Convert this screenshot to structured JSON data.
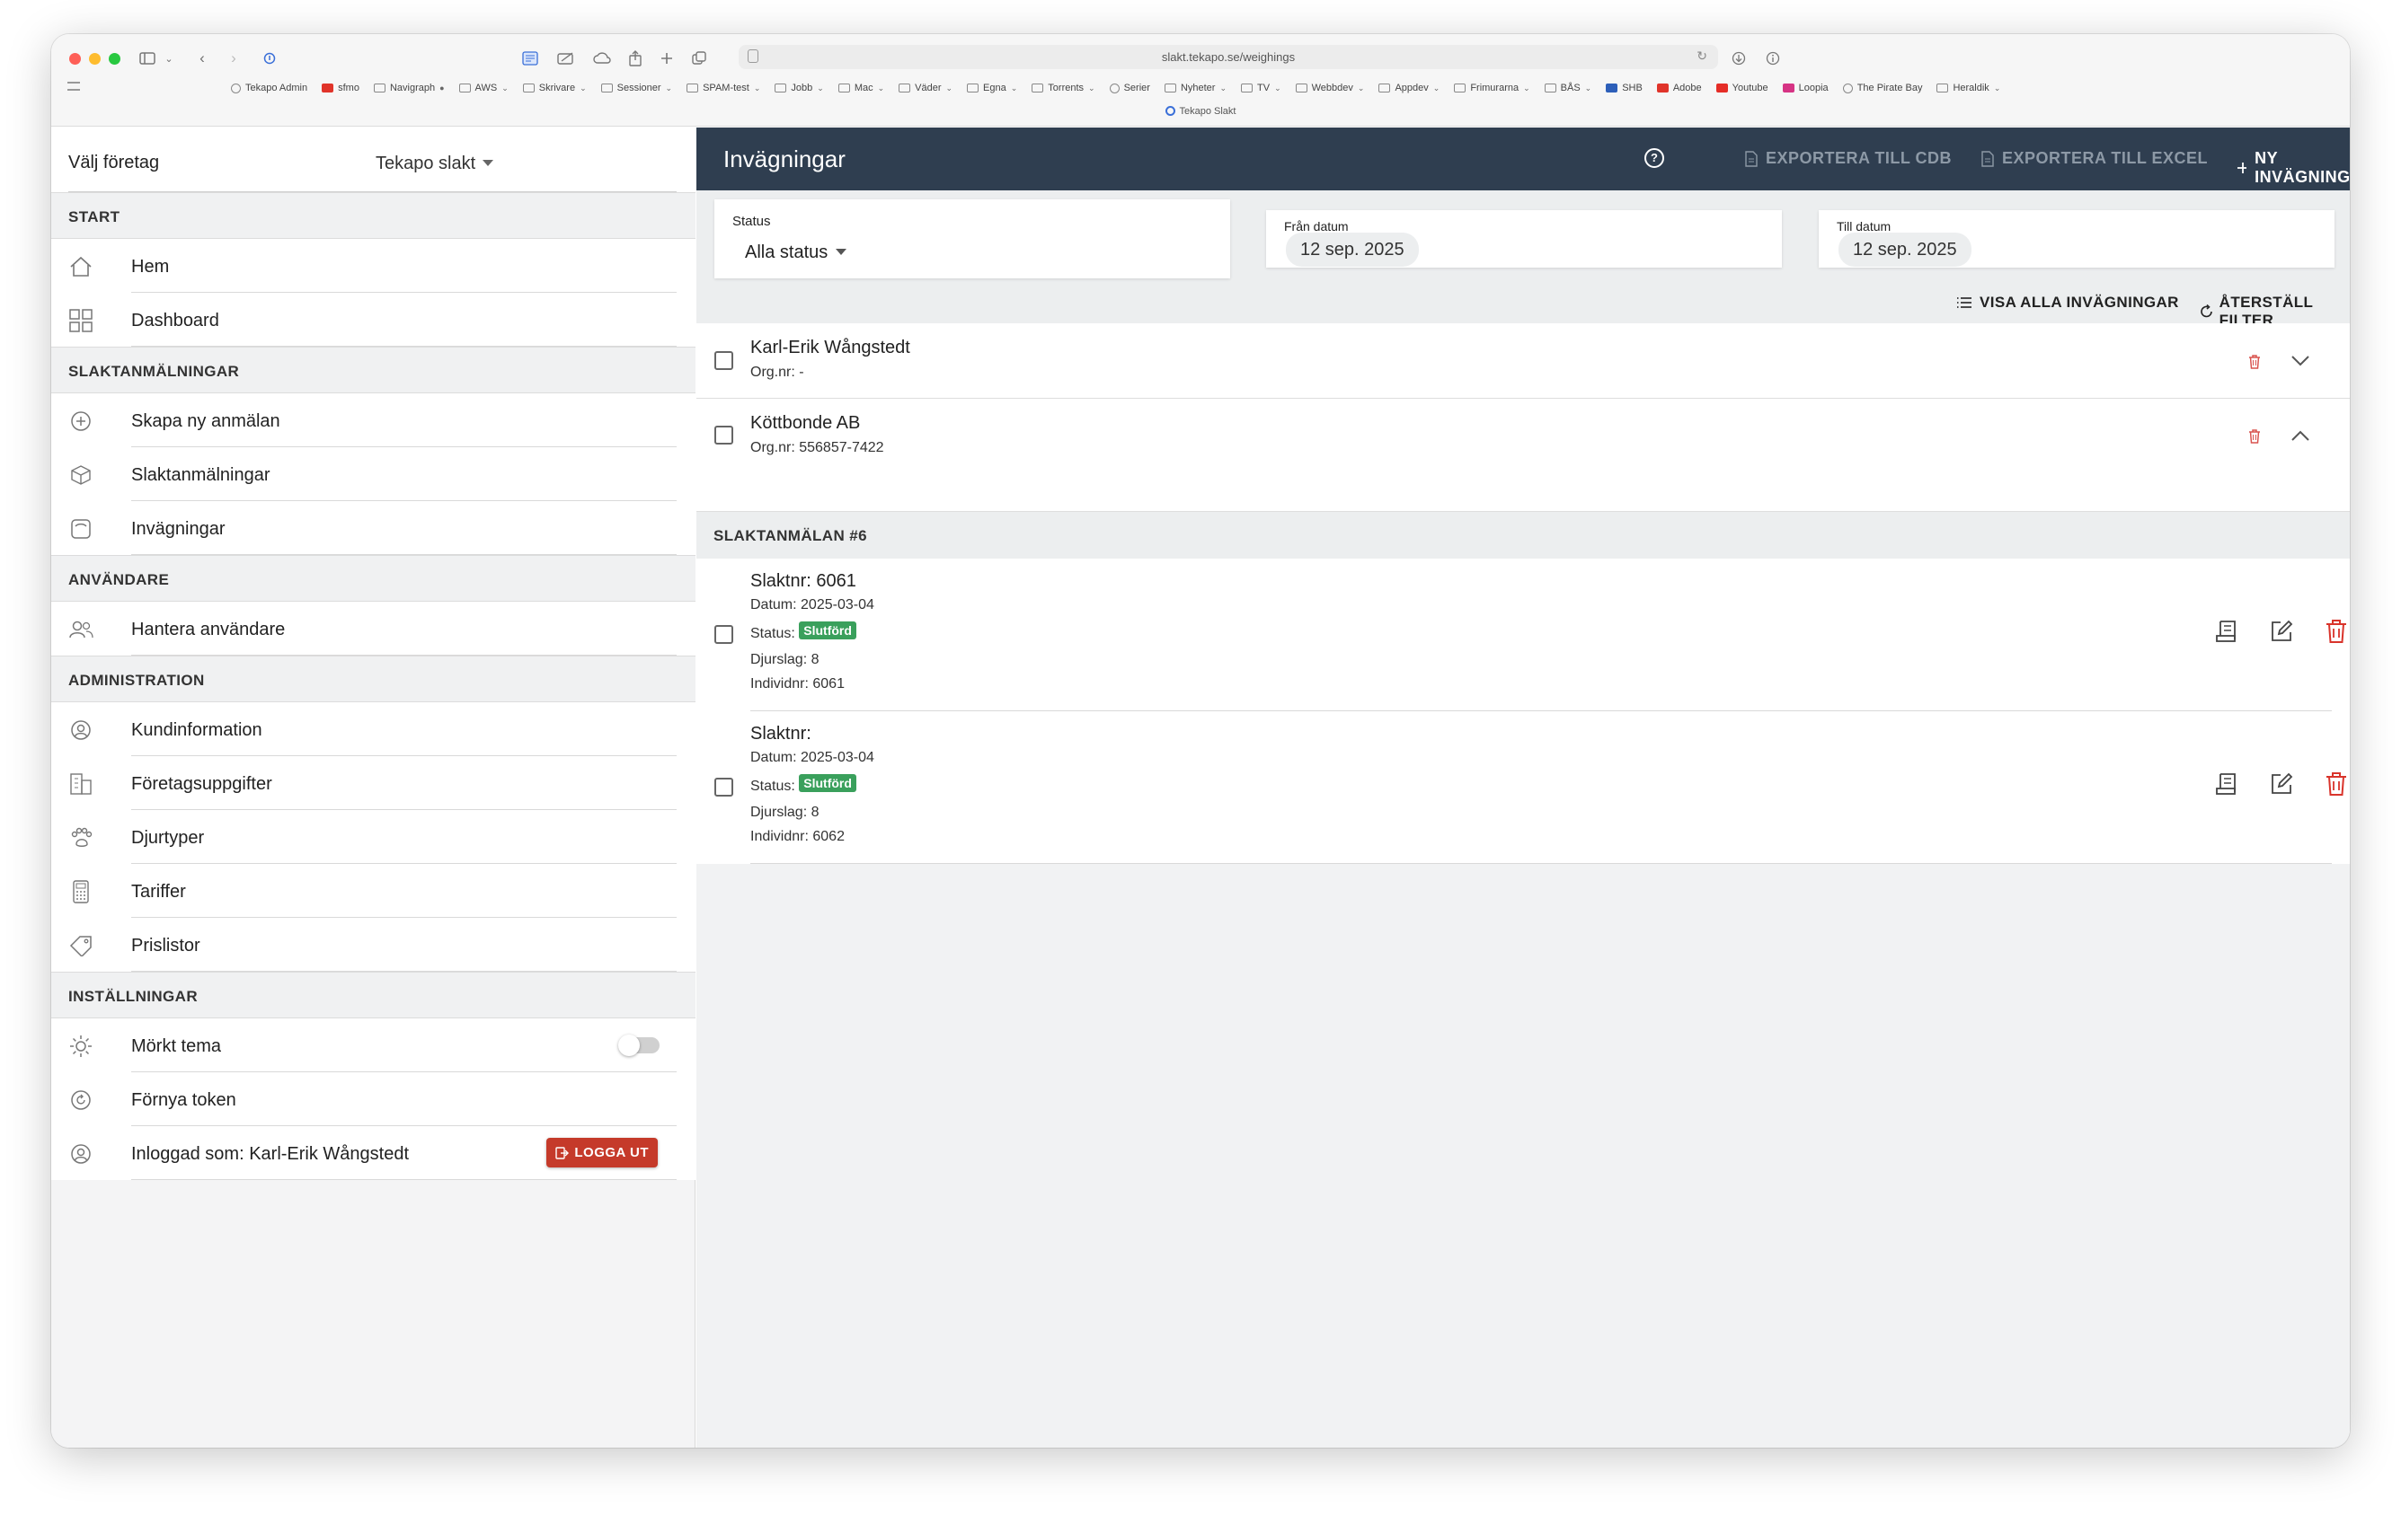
{
  "browser": {
    "url": "slakt.tekapo.se/weighings",
    "tab_title": "Tekapo Slakt",
    "bookmarks": [
      {
        "label": "Tekapo Admin",
        "icon": "globe-icon"
      },
      {
        "label": "sfmo",
        "icon": "red-cross-icon"
      },
      {
        "label": "Navigraph",
        "icon": "folder-icon",
        "chevron": "●"
      },
      {
        "label": "AWS",
        "icon": "folder-icon",
        "chevron": "⌄"
      },
      {
        "label": "Skrivare",
        "icon": "folder-icon",
        "chevron": "⌄"
      },
      {
        "label": "Sessioner",
        "icon": "folder-icon",
        "chevron": "⌄"
      },
      {
        "label": "SPAM-test",
        "icon": "folder-icon",
        "chevron": "⌄"
      },
      {
        "label": "Jobb",
        "icon": "folder-icon",
        "chevron": "⌄"
      },
      {
        "label": "Mac",
        "icon": "folder-icon",
        "chevron": "⌄"
      },
      {
        "label": "Väder",
        "icon": "folder-icon",
        "chevron": "⌄"
      },
      {
        "label": "Egna",
        "icon": "folder-icon",
        "chevron": "⌄"
      },
      {
        "label": "Torrents",
        "icon": "folder-icon",
        "chevron": "⌄"
      },
      {
        "label": "Serier",
        "icon": "globe-icon"
      },
      {
        "label": "Nyheter",
        "icon": "folder-icon",
        "chevron": "⌄"
      },
      {
        "label": "TV",
        "icon": "folder-icon",
        "chevron": "⌄"
      },
      {
        "label": "Webbdev",
        "icon": "folder-icon",
        "chevron": "⌄"
      },
      {
        "label": "Appdev",
        "icon": "folder-icon",
        "chevron": "⌄"
      },
      {
        "label": "Frimurarna",
        "icon": "folder-icon",
        "chevron": "⌄"
      },
      {
        "label": "BÅS",
        "icon": "folder-icon",
        "chevron": "⌄"
      },
      {
        "label": "SHB",
        "icon": "shb-icon"
      },
      {
        "label": "Adobe",
        "icon": "adobe-icon"
      },
      {
        "label": "Youtube",
        "icon": "youtube-icon"
      },
      {
        "label": "Loopia",
        "icon": "loopia-icon"
      },
      {
        "label": "The Pirate Bay",
        "icon": "pirate-icon"
      },
      {
        "label": "Heraldik",
        "icon": "folder-icon",
        "chevron": "⌄"
      }
    ]
  },
  "sidebar": {
    "company_label": "Välj företag",
    "company_value": "Tekapo slakt",
    "sections": {
      "start": "START",
      "slakt": "SLAKTANMÄLNINGAR",
      "users": "ANVÄNDARE",
      "admin": "ADMINISTRATION",
      "settings": "INSTÄLLNINGAR"
    },
    "items": {
      "home": "Hem",
      "dashboard": "Dashboard",
      "create": "Skapa ny anmälan",
      "reports": "Slaktanmälningar",
      "weighings": "Invägningar",
      "manage_users": "Hantera användare",
      "customer": "Kundinformation",
      "company": "Företagsuppgifter",
      "animals": "Djurtyper",
      "tariffs": "Tariffer",
      "prices": "Prislistor",
      "dark": "Mörkt tema",
      "token": "Förnya token",
      "logged_in": "Inloggad som: Karl-Erik Wångstedt"
    },
    "dark_theme_on": false,
    "logout_label": "LOGGA UT"
  },
  "main": {
    "title": "Invägningar",
    "actions": {
      "export_cdb": "EXPORTERA TILL CDB",
      "export_excel": "EXPORTERA TILL EXCEL",
      "new": "NY INVÄGNING"
    },
    "filters": {
      "status_label": "Status",
      "status_value": "Alla status",
      "from_label": "Från datum",
      "from_value": "12 sep. 2025",
      "to_label": "Till datum",
      "to_value": "12 sep. 2025",
      "show_all": "VISA ALLA INVÄGNINGAR",
      "reset": "ÅTERSTÄLL FILTER"
    },
    "suppliers": [
      {
        "name": "Karl-Erik Wångstedt",
        "org": "Org.nr: -",
        "expanded": false
      },
      {
        "name": "Köttbonde AB",
        "org": "Org.nr: 556857-7422",
        "expanded": true
      }
    ],
    "report_header": "SLAKTANMÄLAN #6",
    "entries": [
      {
        "slaktnr": "Slaktnr: 6061",
        "datum": "Datum: 2025-03-04",
        "status_label": "Status:",
        "status": "Slutförd",
        "djurslag": "Djurslag: 8",
        "individnr": "Individnr: 6061"
      },
      {
        "slaktnr": "Slaktnr:",
        "datum": "Datum: 2025-03-04",
        "status_label": "Status:",
        "status": "Slutförd",
        "djurslag": "Djurslag: 8",
        "individnr": "Individnr: 6062"
      }
    ]
  },
  "colors": {
    "topbar": "#2f3e50",
    "accent_green": "#3aa05c",
    "danger_red": "#c53a2a"
  }
}
